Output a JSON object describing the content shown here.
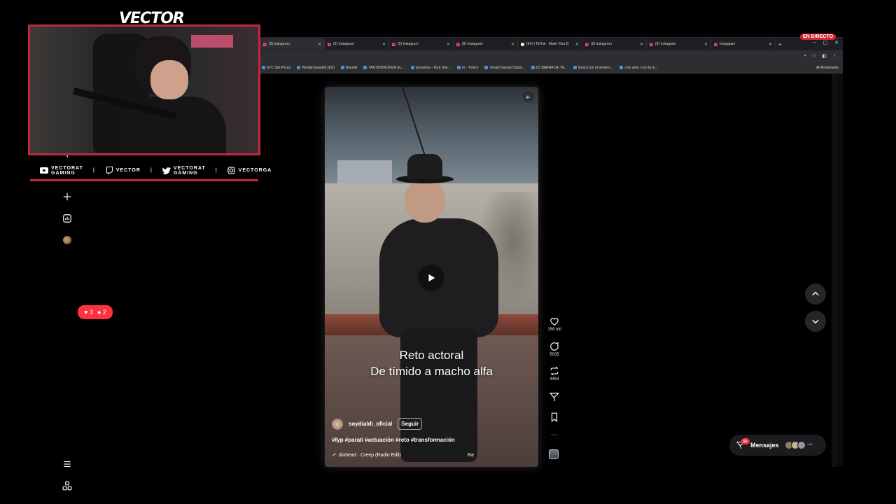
{
  "overlay": {
    "brand": "VECTOR",
    "live_badge": "EN DIRECTO",
    "socials": [
      {
        "icon": "youtube-icon",
        "line1": "VECTORAT",
        "line2": "GAMING"
      },
      {
        "icon": "twitch-icon",
        "line1": "VECTOR",
        "line2": ""
      },
      {
        "icon": "twitter-icon",
        "line1": "VECTORAT",
        "line2": "GAMING"
      },
      {
        "icon": "instagram-icon",
        "line1": "VECTORGA",
        "line2": ""
      }
    ],
    "accent": "#c4273d"
  },
  "browser": {
    "tabs": [
      {
        "label": "(9) Instagram",
        "icon": "instagram-icon",
        "active": true
      },
      {
        "label": "(9) Instagram",
        "icon": "instagram-icon",
        "active": false
      },
      {
        "label": "(9) Instagram",
        "icon": "instagram-icon",
        "active": false
      },
      {
        "label": "(9) Instagram",
        "icon": "instagram-icon",
        "active": false
      },
      {
        "label": "(99+) TikTok - Make Your D",
        "icon": "tiktok-icon",
        "active": false
      },
      {
        "label": "(9) Instagram",
        "icon": "instagram-icon",
        "active": false
      },
      {
        "label": "(9) Instagram",
        "icon": "instagram-icon",
        "active": false
      },
      {
        "label": "Instagram",
        "icon": "instagram-icon",
        "active": false
      }
    ],
    "bookmarks": [
      "STC Set Prices",
      "Wordle Español (ES)",
      "Boludle",
      "TAN BIONICA EN EL...",
      "sionamon - Kick Stat...",
      "rrr - Twitch",
      "Tenuki Sunset Classi...",
      "(2) BARRA DE TA...",
      "Buscó por el término...",
      "cion amo | con la m..."
    ],
    "all_bookmarks": "All Bookmarks"
  },
  "instagram": {
    "sidebar_badge": "9+",
    "notifications": {
      "likes": "3",
      "follows": "2"
    },
    "reel": {
      "caption_line1": "Reto actoral",
      "caption_line2": "De tímido a macho alfa",
      "username": "soydialdi_oficial",
      "follow_label": "Seguir",
      "hashtags": "#fyp #parati #actuación #reto #transformación",
      "audio": "diohead · Creep (Radio Edit)",
      "audio_extra": "Ra"
    },
    "actions": {
      "likes": "159 mil",
      "comments": "5035",
      "reposts": "4464"
    },
    "messages": {
      "label": "Mensajes",
      "badge": "9+"
    }
  }
}
